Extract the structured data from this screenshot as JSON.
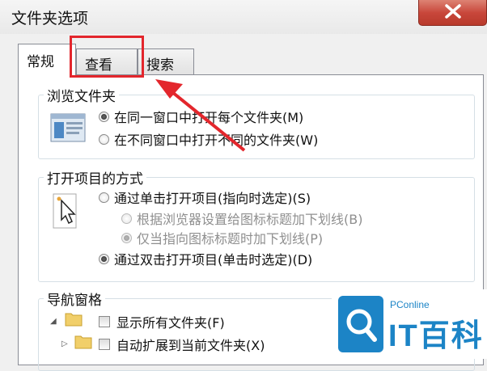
{
  "window": {
    "title": "文件夹选项",
    "close_icon": "close-icon"
  },
  "tabs": [
    {
      "label": "常规",
      "active": true
    },
    {
      "label": "查看",
      "active": false
    },
    {
      "label": "搜索",
      "active": false
    }
  ],
  "browse_folders": {
    "title": "浏览文件夹",
    "options": [
      {
        "label": "在同一窗口中打开每个文件夹(M)",
        "checked": true
      },
      {
        "label": "在不同窗口中打开不同的文件夹(W)",
        "checked": false
      }
    ]
  },
  "click_items": {
    "title": "打开项目的方式",
    "options": [
      {
        "label": "通过单击打开项目(指向时选定)(S)",
        "checked": false,
        "enabled": true
      },
      {
        "label": "根据浏览器设置给图标标题加下划线(B)",
        "checked": false,
        "enabled": false
      },
      {
        "label": "仅当指向图标标题时加下划线(P)",
        "checked": true,
        "enabled": false
      },
      {
        "label": "通过双击打开项目(单击时选定)(D)",
        "checked": true,
        "enabled": true
      }
    ]
  },
  "navigation_pane": {
    "title": "导航窗格",
    "options": [
      {
        "label": "显示所有文件夹(F)",
        "checked": false
      },
      {
        "label": "自动扩展到当前文件夹(X)",
        "checked": false
      }
    ]
  },
  "watermark": {
    "small": "PConline",
    "big": "IT百科",
    "color": "#1c84c6"
  },
  "annotation": {
    "color": "#e3262c"
  }
}
